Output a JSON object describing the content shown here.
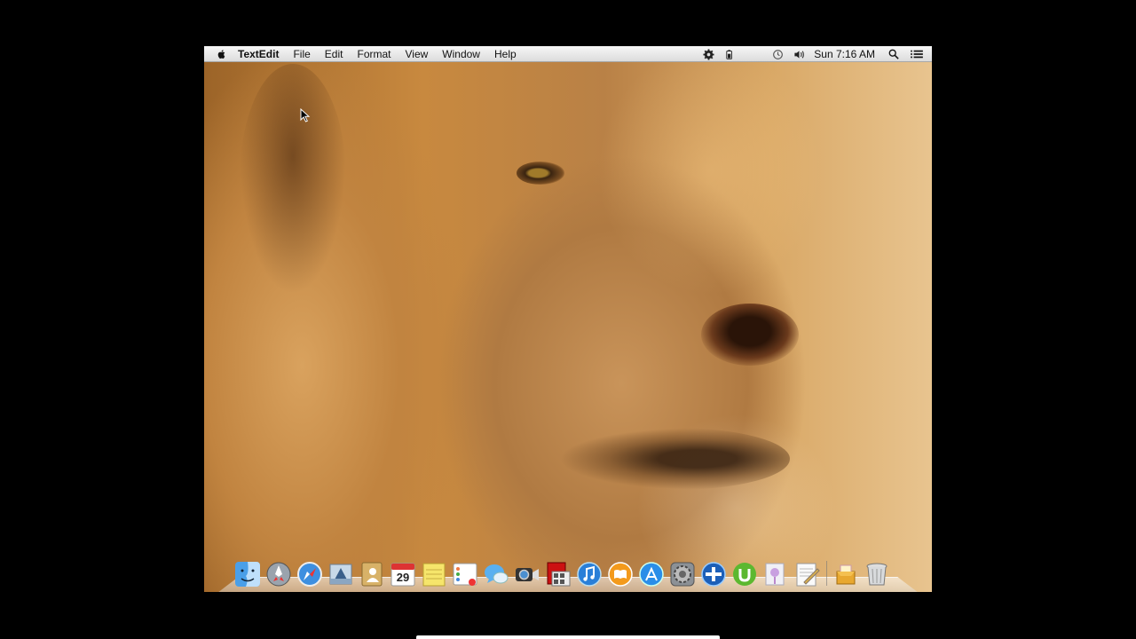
{
  "menubar": {
    "app_name": "TextEdit",
    "menus": [
      "File",
      "Edit",
      "Format",
      "View",
      "Window",
      "Help"
    ],
    "clock": "Sun 7:16 AM",
    "status_icons": [
      "gear-icon",
      "battery-icon",
      "time-machine-icon",
      "volume-icon",
      "spotlight-icon",
      "notification-list-icon"
    ]
  },
  "desktop": {
    "wallpaper": "lion"
  },
  "dock": {
    "calendar_day": "29",
    "apps": [
      "finder",
      "launchpad",
      "safari",
      "mail",
      "contacts",
      "calendar",
      "notes",
      "reminders",
      "messages",
      "facetime",
      "photo-booth",
      "itunes",
      "ibooks",
      "app-store",
      "system-preferences",
      "mission-control",
      "utorrent",
      "preview",
      "textedit",
      "downloads-stack",
      "trash"
    ]
  },
  "colors": {
    "menubar_bg": "#e9e9e9",
    "accent_blue": "#1f7ae0"
  }
}
